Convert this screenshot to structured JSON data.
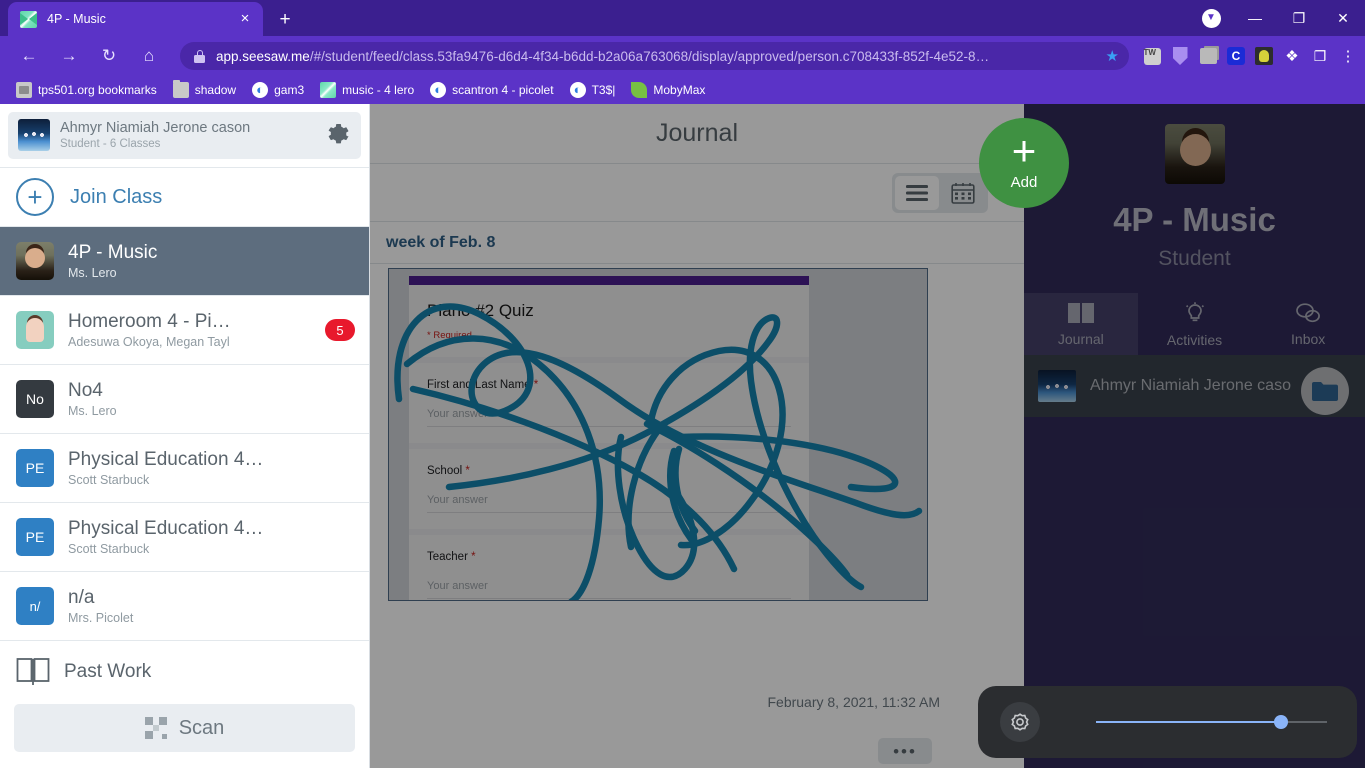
{
  "browser": {
    "tab": {
      "title": "4P - Music",
      "favicon": "seesaw-icon",
      "close": "×"
    },
    "new_tab": "+",
    "window": {
      "download": "▼",
      "minimize": "—",
      "maximize": "❐",
      "close": "✕"
    },
    "nav": {
      "back": "←",
      "forward": "→",
      "reload": "↻",
      "home": "⌂"
    },
    "omnibox": {
      "host": "app.seesaw.me",
      "path": "/#/student/feed/class.53fa9476-d6d4-4f34-b6dd-b2a06a763068/display/approved/person.c708433f-852f-4e52-8…",
      "lock": "lock-icon",
      "star": "★"
    },
    "extensions": [
      {
        "name": "tw-extension-icon",
        "label": "TW"
      },
      {
        "name": "shield-extension-icon",
        "label": ""
      },
      {
        "name": "stack-extension-icon",
        "label": ""
      },
      {
        "name": "clever-extension-icon",
        "label": "C"
      },
      {
        "name": "character-extension-icon",
        "label": ""
      },
      {
        "name": "puzzle-extensions-icon",
        "label": "❖"
      },
      {
        "name": "cast-icon",
        "label": "❐"
      },
      {
        "name": "chrome-menu-icon",
        "label": "⋮"
      }
    ],
    "bookmarks": [
      {
        "label": "tps501.org bookmarks",
        "icon": "folder-doc"
      },
      {
        "label": "shadow",
        "icon": "folder"
      },
      {
        "label": "gam3",
        "icon": "globe"
      },
      {
        "label": "music - 4 lero",
        "icon": "seesaw"
      },
      {
        "label": "scantron 4  - picolet",
        "icon": "globe"
      },
      {
        "label": "T3$|",
        "icon": "globe"
      },
      {
        "label": "MobyMax",
        "icon": "leaf"
      }
    ]
  },
  "sidebar": {
    "profile": {
      "name": "Ahmyr Niamiah Jerone cason",
      "subtitle": "Student - 6 Classes",
      "settings_icon": "gear-icon"
    },
    "join_class": {
      "label": "Join Class",
      "plus": "+"
    },
    "classes": [
      {
        "name": "4P - Music",
        "teachers": "Ms. Lero",
        "avatar": "ava-lero",
        "initials": "",
        "badge": "",
        "active": true
      },
      {
        "name": "Homeroom 4 - Pi…",
        "teachers": "Adesuwa Okoya,  Megan Tayl",
        "avatar": "ava-hr",
        "initials": "",
        "badge": "5",
        "active": false
      },
      {
        "name": "No4",
        "teachers": "Ms. Lero",
        "avatar": "ava-no",
        "initials": "No",
        "badge": "",
        "active": false
      },
      {
        "name": "Physical Education 4…",
        "teachers": "Scott Starbuck",
        "avatar": "ava-pe",
        "initials": "PE",
        "badge": "",
        "active": false
      },
      {
        "name": "Physical Education 4…",
        "teachers": "Scott Starbuck",
        "avatar": "ava-pe",
        "initials": "PE",
        "badge": "",
        "active": false
      },
      {
        "name": "n/a",
        "teachers": "Mrs. Picolet",
        "avatar": "ava-na",
        "initials": "n/",
        "badge": "",
        "active": false
      }
    ],
    "past_work": {
      "label": "Past Work",
      "icon": "book-icon"
    },
    "scan": {
      "label": "Scan",
      "icon": "qr-code-icon"
    }
  },
  "main": {
    "title": "Journal",
    "view_toggle": {
      "list": "list-view-icon",
      "calendar": "calendar-view-icon",
      "selected": "list"
    },
    "week_label": "week of Feb. 8",
    "post": {
      "date": "February 8, 2021, 11:32 AM",
      "more": "•••",
      "form": {
        "title": "Piano #2 Quiz",
        "required_note": "* Required",
        "questions": [
          {
            "label": "First and Last Name",
            "required": "*",
            "answer_placeholder": "Your answer"
          },
          {
            "label": "School",
            "required": "*",
            "answer_placeholder": "Your answer"
          },
          {
            "label": "Teacher",
            "required": "*",
            "answer_placeholder": "Your answer"
          }
        ]
      }
    }
  },
  "fab": {
    "label": "Add",
    "plus": "+"
  },
  "right_panel": {
    "class_name": "4P - Music",
    "role": "Student",
    "tabs": [
      {
        "label": "Journal",
        "icon": "journal-icon",
        "selected": true
      },
      {
        "label": "Activities",
        "icon": "lightbulb-icon",
        "selected": false
      },
      {
        "label": "Inbox",
        "icon": "chat-bubbles-icon",
        "selected": false
      }
    ],
    "student_row": {
      "name": "Ahmyr Niamiah Jerone caso",
      "folder_icon": "folder-icon"
    }
  },
  "brightness_tray": {
    "icon": "brightness-icon",
    "value_percent": 80
  },
  "colors": {
    "chrome_purple": "#5b33c7",
    "chrome_tabstrip": "#3b1f8f",
    "seesaw_green": "#3f9142",
    "right_panel": "#312b59",
    "active_class": "#5d6d7e",
    "badge_red": "#e8192c",
    "link_blue": "#3c7fb1",
    "scribble_teal": "#1583ad",
    "slider_blue": "#8ab4f8"
  }
}
